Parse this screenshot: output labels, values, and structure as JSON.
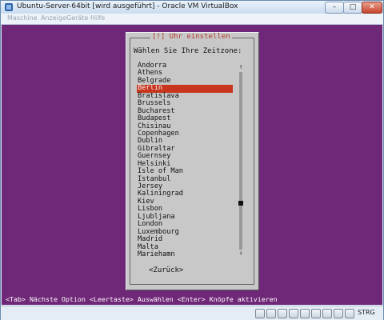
{
  "window": {
    "title": "Ubuntu-Server-64bit [wird ausgeführt] - Oracle VM VirtualBox",
    "controls": {
      "minimize": "–",
      "maximize": "□",
      "close": "✕"
    }
  },
  "menubar": [
    "Maschine",
    "Anzeige",
    "Geräte",
    "Hilfe"
  ],
  "dialog": {
    "title": "[!] Uhr einstellen",
    "prompt": "Wählen Sie Ihre Zeitzone:",
    "timezones": [
      "Andorra",
      "Athens",
      "Belgrade",
      "Berlin",
      "Bratislava",
      "Brussels",
      "Bucharest",
      "Budapest",
      "Chisinau",
      "Copenhagen",
      "Dublin",
      "Gibraltar",
      "Guernsey",
      "Helsinki",
      "Isle of Man",
      "Istanbul",
      "Jersey",
      "Kaliningrad",
      "Kiev",
      "Lisbon",
      "Ljubljana",
      "London",
      "Luxembourg",
      "Madrid",
      "Malta",
      "Mariehamn"
    ],
    "selected": "Berlin",
    "back_button": "<Zurück>",
    "scroll_up": "↑",
    "scroll_down": "↓"
  },
  "hint": "<Tab> Nächste Option <Leertaste> Auswählen <Enter> Knöpfe aktivieren",
  "statusbar": {
    "host_key": "STRG",
    "icons": [
      "hard-disk-icon",
      "optical-drive-icon",
      "usb-icon",
      "network-icon",
      "shared-folder-icon",
      "display-icon",
      "recording-icon",
      "mouse-integration-icon",
      "keyboard-capture-icon"
    ]
  },
  "colors": {
    "screen_bg": "#6f2777",
    "dialog_bg": "#c8c8c8",
    "selection": "#c8341c",
    "dialog_title": "#b33a2a"
  }
}
